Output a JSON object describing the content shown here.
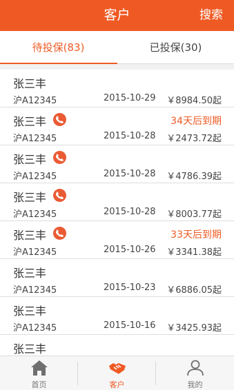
{
  "header": {
    "title": "客户",
    "search_label": "搜索"
  },
  "tabs": [
    {
      "label": "待投保(83)",
      "active": true
    },
    {
      "label": "已投保(30)",
      "active": false
    }
  ],
  "customers": [
    {
      "name": "张三丰",
      "has_phone": false,
      "plate": "沪A12345",
      "date": "2015-10-29",
      "price": "￥8984.50起",
      "expire": ""
    },
    {
      "name": "张三丰",
      "has_phone": true,
      "plate": "沪A12345",
      "date": "2015-10-28",
      "price": "￥2473.72起",
      "expire": "34天后到期"
    },
    {
      "name": "张三丰",
      "has_phone": true,
      "plate": "沪A12345",
      "date": "2015-10-28",
      "price": "￥4786.39起",
      "expire": ""
    },
    {
      "name": "张三丰",
      "has_phone": true,
      "plate": "沪A12345",
      "date": "2015-10-28",
      "price": "￥8003.77起",
      "expire": ""
    },
    {
      "name": "张三丰",
      "has_phone": true,
      "plate": "沪A12345",
      "date": "2015-10-26",
      "price": "￥3341.38起",
      "expire": "33天后到期"
    },
    {
      "name": "张三丰",
      "has_phone": false,
      "plate": "沪A12345",
      "date": "2015-10-23",
      "price": "￥6886.05起",
      "expire": ""
    },
    {
      "name": "张三丰",
      "has_phone": false,
      "plate": "沪A12345",
      "date": "2015-10-16",
      "price": "￥3425.93起",
      "expire": ""
    },
    {
      "name": "张三丰",
      "has_phone": false,
      "plate": "",
      "date": "",
      "price": "",
      "expire": ""
    }
  ],
  "bottom_nav": [
    {
      "label": "首页",
      "icon": "home-icon",
      "active": false
    },
    {
      "label": "客户",
      "icon": "handshake-icon",
      "active": true
    },
    {
      "label": "我的",
      "icon": "person-icon",
      "active": false
    }
  ],
  "colors": {
    "accent": "#ef5a24",
    "phone_badge": "#ea5b34",
    "inactive_icon": "#6f6f6f"
  }
}
